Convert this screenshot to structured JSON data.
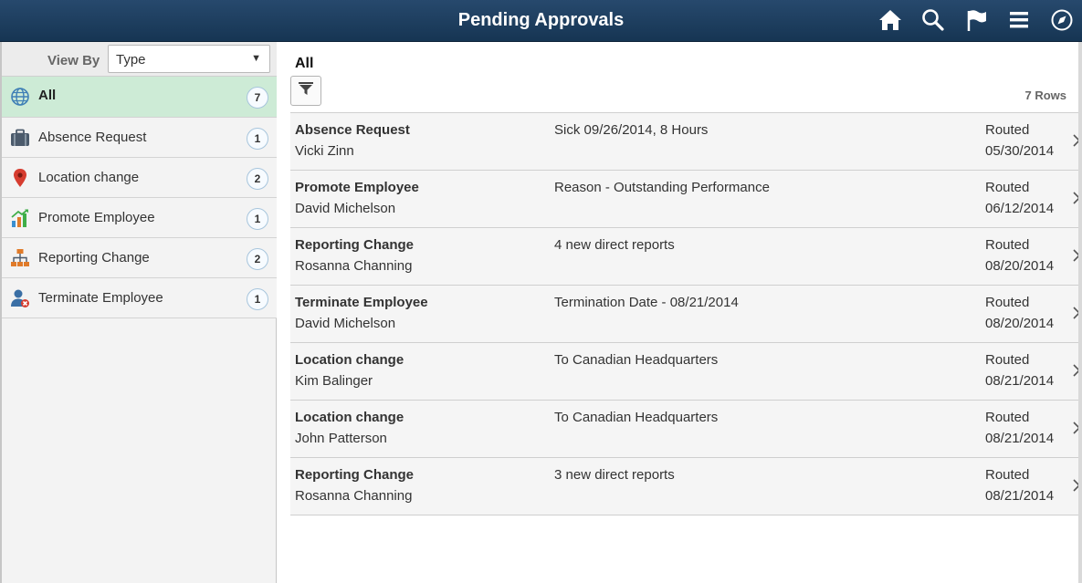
{
  "header": {
    "title": "Pending Approvals",
    "icons": [
      "home-icon",
      "search-icon",
      "flag-icon",
      "menu-icon",
      "navbar-icon"
    ]
  },
  "sidebar": {
    "view_by_label": "View By",
    "view_by_value": "Type",
    "items": [
      {
        "label": "All",
        "count": "7",
        "icon": "globe-icon",
        "selected": true
      },
      {
        "label": "Absence Request",
        "count": "1",
        "icon": "briefcase-icon"
      },
      {
        "label": "Location change",
        "count": "2",
        "icon": "map-pin-icon"
      },
      {
        "label": "Promote Employee",
        "count": "1",
        "icon": "growth-chart-icon"
      },
      {
        "label": "Reporting Change",
        "count": "2",
        "icon": "org-chart-icon"
      },
      {
        "label": "Terminate Employee",
        "count": "1",
        "icon": "remove-user-icon"
      }
    ]
  },
  "main": {
    "section_title": "All",
    "rows_count": "7 Rows",
    "rows": [
      {
        "type": "Absence Request",
        "name": "Vicki Zinn",
        "description": "Sick 09/26/2014, 8 Hours",
        "status": "Routed",
        "date": "05/30/2014"
      },
      {
        "type": "Promote Employee",
        "name": "David Michelson",
        "description": "Reason - Outstanding Performance",
        "status": "Routed",
        "date": "06/12/2014"
      },
      {
        "type": "Reporting Change",
        "name": "Rosanna Channing",
        "description": "4 new direct reports",
        "status": "Routed",
        "date": "08/20/2014"
      },
      {
        "type": "Terminate Employee",
        "name": "David Michelson",
        "description": "Termination Date - 08/21/2014",
        "status": "Routed",
        "date": "08/20/2014"
      },
      {
        "type": "Location change",
        "name": "Kim Balinger",
        "description": "To Canadian Headquarters",
        "status": "Routed",
        "date": "08/21/2014"
      },
      {
        "type": "Location change",
        "name": "John Patterson",
        "description": "To Canadian Headquarters",
        "status": "Routed",
        "date": "08/21/2014"
      },
      {
        "type": "Reporting Change",
        "name": "Rosanna Channing",
        "description": "3 new direct reports",
        "status": "Routed",
        "date": "08/21/2014"
      }
    ]
  },
  "colors": {
    "header_bg": "#1f4163",
    "selected_item_bg": "#cdebd6",
    "count_badge_border": "#a7c5dc"
  }
}
